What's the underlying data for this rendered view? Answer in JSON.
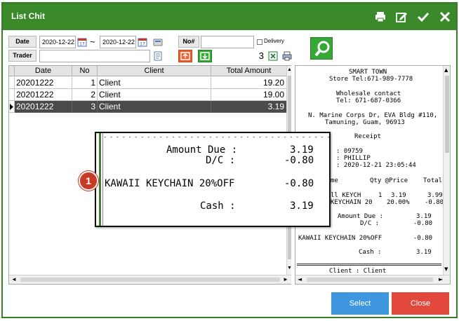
{
  "window": {
    "title": "List Chit"
  },
  "filters": {
    "date_label": "Date",
    "date_from": "2020-12-22",
    "date_sep": "~",
    "date_to": "2020-12-22",
    "trader_label": "Trader",
    "trader_value": "",
    "no_label": "No#",
    "no_value": "",
    "delivery_label": "Delivery",
    "count": "3"
  },
  "grid": {
    "headers": [
      "Date",
      "No",
      "Client",
      "Total Amount"
    ],
    "rows": [
      {
        "date": "20201222",
        "no": "1",
        "client": "Client",
        "total": "19.20"
      },
      {
        "date": "20201222",
        "no": "2",
        "client": "Client",
        "total": "19.00"
      },
      {
        "date": "20201222",
        "no": "3",
        "client": "Client",
        "total": "3.19"
      }
    ]
  },
  "receipt": {
    "lines": [
      "SMART TOWN",
      "Store Tel:671-989-7778",
      "Wholesale contact",
      "Tel: 671-687-0366",
      "N. Marine Corps Dr, EVA Bldg #110,",
      "Tamuning, Guam, 96913",
      "Receipt",
      ": 09759",
      ": PHILLIP",
      ": 2020-12-21 23:05:44",
      "me",
      "Qty @Price",
      "Total",
      "ll KEYCH",
      "1",
      "3.19",
      "3.99",
      "KEYCHAIN 20",
      "20.00%",
      "-0.80",
      "Amount Due :",
      "3.19",
      "D/C :",
      "-0.80",
      "KAWAII KEYCHAIN 20%OFF",
      "-0.80",
      "Cash :",
      "3.19",
      "Client : Client"
    ]
  },
  "popup": {
    "separator": "- - - - - - - - - - - - - - - - - - - - - - - - - - - - - - - - - - - - - - - - - -",
    "amount_due_label": "Amount Due :",
    "amount_due_value": "3.19",
    "dc_label": "D/C :",
    "dc_value": "-0.80",
    "item_label": "KAWAII KEYCHAIN 20%OFF",
    "item_value": "-0.80",
    "cash_label": "Cash :",
    "cash_value": "3.19"
  },
  "callout": {
    "number": "1"
  },
  "buttons": {
    "select": "Select",
    "close": "Close"
  },
  "colors": {
    "title_bar": "#3a8a2c",
    "select": "#3d96de",
    "close": "#e2483c",
    "selected_row": "#4a4a4a",
    "badge": "#c73a25"
  }
}
